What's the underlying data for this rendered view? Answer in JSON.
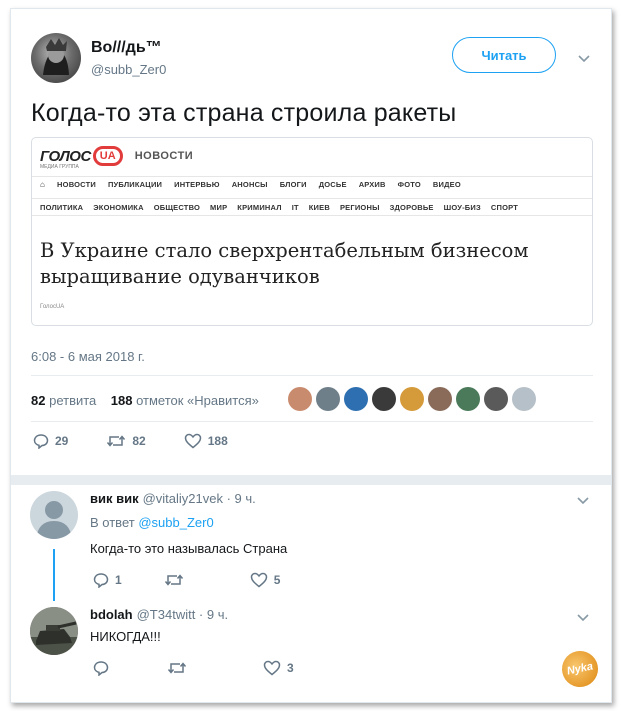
{
  "tweet": {
    "display_name": "Во///дь™",
    "handle": "@subb_Zer0",
    "follow_label": "Читать",
    "text": "Когда-то эта страна строила ракеты",
    "timestamp": "6:08 - 6 мая 2018 г.",
    "card": {
      "logo_left": "ГОЛОС",
      "logo_badge": "UA",
      "logo_right": "НОВОСТИ",
      "logo_sub": "МЕДИА ГРУППА",
      "nav_top": [
        "НОВОСТИ",
        "ПУБЛИКАЦИИ",
        "ИНТЕРВЬЮ",
        "АНОНСЫ",
        "БЛОГИ",
        "ДОСЬЕ",
        "АРХИВ",
        "ФОТО",
        "ВИДЕО"
      ],
      "nav_bottom": [
        "ПОЛИТИКА",
        "ЭКОНОМИКА",
        "ОБЩЕСТВО",
        "МИР",
        "КРИМИНАЛ",
        "IT",
        "КИЕВ",
        "РЕГИОНЫ",
        "ЗДОРОВЬЕ",
        "ШОУ-БИЗ",
        "СПОРТ"
      ],
      "headline": "В Украине стало сверхрентабельным бизнесом выращивание одуванчиков",
      "source": "ГолосUA"
    },
    "stats": {
      "retweets_count": "82",
      "retweets_label": "ретвита",
      "likes_count": "188",
      "likes_label": "отметок «Нравится»"
    },
    "liker_colors": [
      "#c98b6e",
      "#6f7f8a",
      "#2d6fb0",
      "#3a3a3a",
      "#d59a3a",
      "#8a6b5a",
      "#4a7a5a",
      "#5a5a5a",
      "#b6c0c8"
    ],
    "actions": {
      "replies": "29",
      "retweets": "82",
      "likes": "188"
    }
  },
  "replies": [
    {
      "name": "вик вик",
      "handle": "@vitaliy21vek · 9 ч.",
      "in_reply_prefix": "В ответ",
      "in_reply_to": "@subb_Zer0",
      "text": "Когда-то это называлась Страна",
      "actions": {
        "replies": "1",
        "retweets": "",
        "likes": "5"
      }
    },
    {
      "name": "bdolah",
      "handle": "@T34twitt · 9 ч.",
      "text": "НИКОГДА!!!",
      "actions": {
        "replies": "",
        "retweets": "",
        "likes": "3"
      }
    }
  ],
  "watermark": "Nyka",
  "colors": {
    "accent": "#1da1f2",
    "muted": "#657786",
    "text": "#14171a"
  }
}
